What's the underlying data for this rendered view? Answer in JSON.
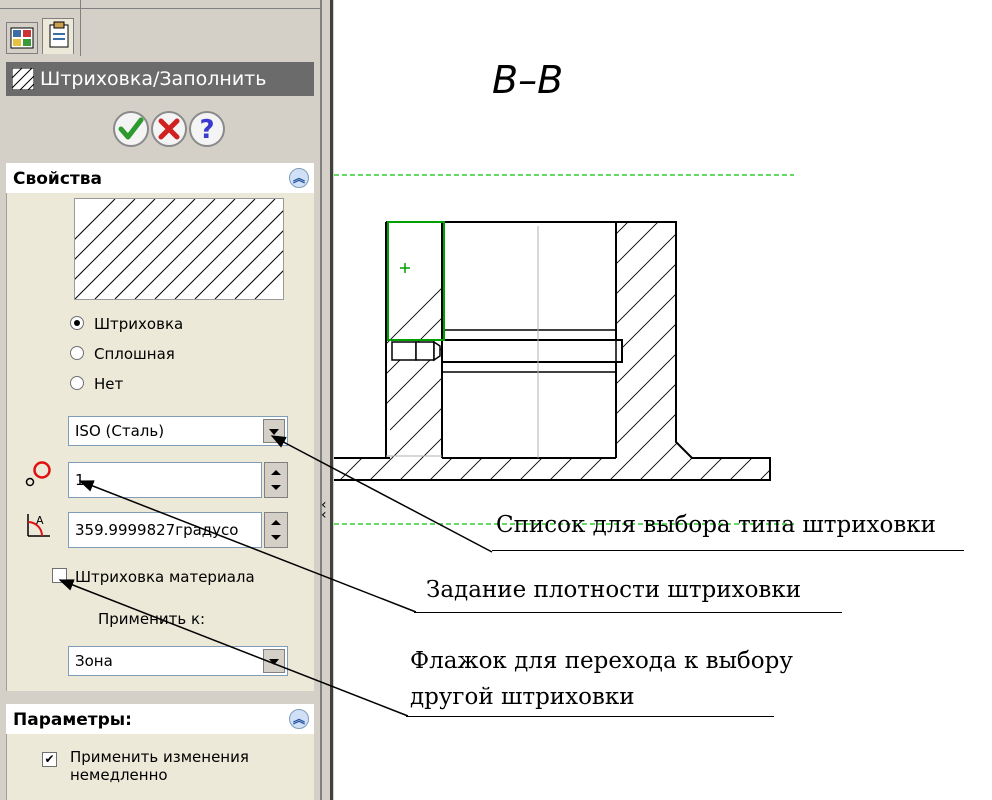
{
  "panel": {
    "title": "Штриховка/Заполнить",
    "icons": {
      "tab1": "feature-manager-icon",
      "tab2": "property-manager-icon",
      "ok": "check-icon",
      "cancel": "x-icon",
      "help": "help-icon"
    },
    "properties": {
      "header": "Свойства",
      "radio_options": [
        {
          "label": "Штриховка",
          "selected": true
        },
        {
          "label": "Сплошная",
          "selected": false
        },
        {
          "label": "Нет",
          "selected": false
        }
      ],
      "pattern_value": "ISO (Сталь)",
      "scale_value": "1",
      "angle_value": "359.9999827градусо",
      "material_hatch_label": "Штриховка материала",
      "material_hatch_checked": false,
      "apply_to_label": "Применить к:",
      "apply_to_value": "Зона"
    },
    "parameters": {
      "header": "Параметры:",
      "apply_immediately_label": "Применить изменения немедленно",
      "apply_immediately_checked": true
    }
  },
  "drawing": {
    "section_label": "B–B"
  },
  "annotations": {
    "hatch_type_list": "Список для выбора типа штриховки",
    "hatch_density": "Задание плотности штриховки",
    "other_hatch_flag_line1": "Флажок для перехода к выбору",
    "other_hatch_flag_line2": "другой штриховки"
  },
  "colors": {
    "panel_bg": "#d4d0c8",
    "title_bar": "#6b6b6b",
    "selection_green": "#00a000",
    "centerline_green": "#33cc33"
  }
}
